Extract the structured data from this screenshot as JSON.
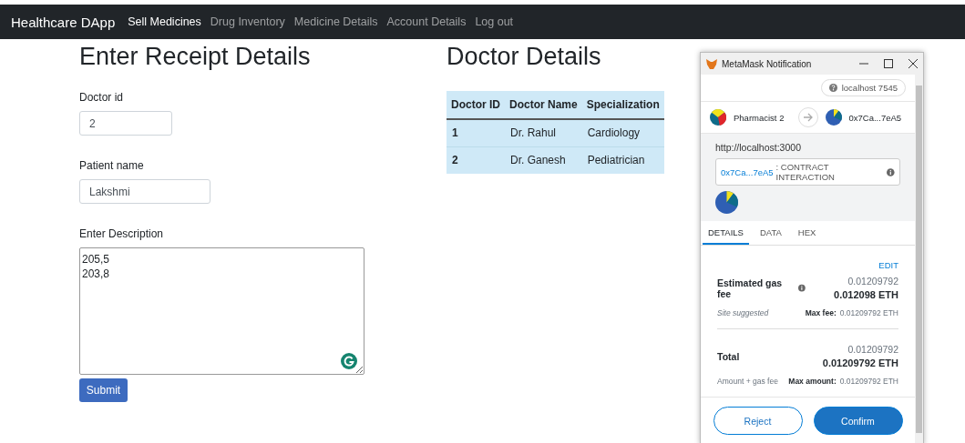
{
  "navbar": {
    "brand": "Healthcare DApp",
    "links": [
      {
        "label": "Sell Medicines",
        "selected": true
      },
      {
        "label": "Drug Inventory",
        "selected": false
      },
      {
        "label": "Medicine Details",
        "selected": false
      },
      {
        "label": "Account Details",
        "selected": false
      },
      {
        "label": "Log out",
        "selected": false
      }
    ]
  },
  "receipt_form": {
    "title": "Enter Receipt Details",
    "fields": [
      {
        "label": "Doctor id",
        "value": "2",
        "kind": "short"
      },
      {
        "label": "Patient name",
        "value": "Lakshmi",
        "kind": "medium"
      },
      {
        "label": "Enter Description",
        "value": "205,5\n203,8",
        "kind": "textarea"
      }
    ],
    "submit": "Submit"
  },
  "doctor_details": {
    "title": "Doctor Details",
    "table": {
      "columns": [
        "Doctor ID",
        "Doctor Name",
        "Specialization"
      ],
      "rows": [
        [
          "1",
          "Dr. Rahul",
          "Cardiology"
        ],
        [
          "2",
          "Dr. Ganesh",
          "Pediatrician"
        ]
      ]
    }
  },
  "metamask": {
    "window_title": "MetaMask Notification",
    "network": "localhost 7545",
    "from_account": "Pharmacist 2",
    "to_account": "0x7Ca...7eA5",
    "origin": "http://localhost:3000",
    "contract_address": "0x7Ca...7eA5",
    "contract_label": ": CONTRACT INTERACTION",
    "tabs": [
      {
        "label": "DETAILS",
        "selected": true
      },
      {
        "label": "DATA",
        "selected": false
      },
      {
        "label": "HEX",
        "selected": false
      }
    ],
    "edit": "EDIT",
    "gas": {
      "label": "Estimated gas fee",
      "value": "0.01209792",
      "eth": "0.012098 ETH",
      "note": "Site suggested",
      "max_label": "Max fee:",
      "max_value": "0.01209792 ETH"
    },
    "total": {
      "label": "Total",
      "value": "0.01209792",
      "eth": "0.01209792 ETH",
      "note": "Amount + gas fee",
      "max_label": "Max amount:",
      "max_value": "0.01209792 ETH"
    },
    "buttons": {
      "reject": "Reject",
      "confirm": "Confirm"
    }
  }
}
